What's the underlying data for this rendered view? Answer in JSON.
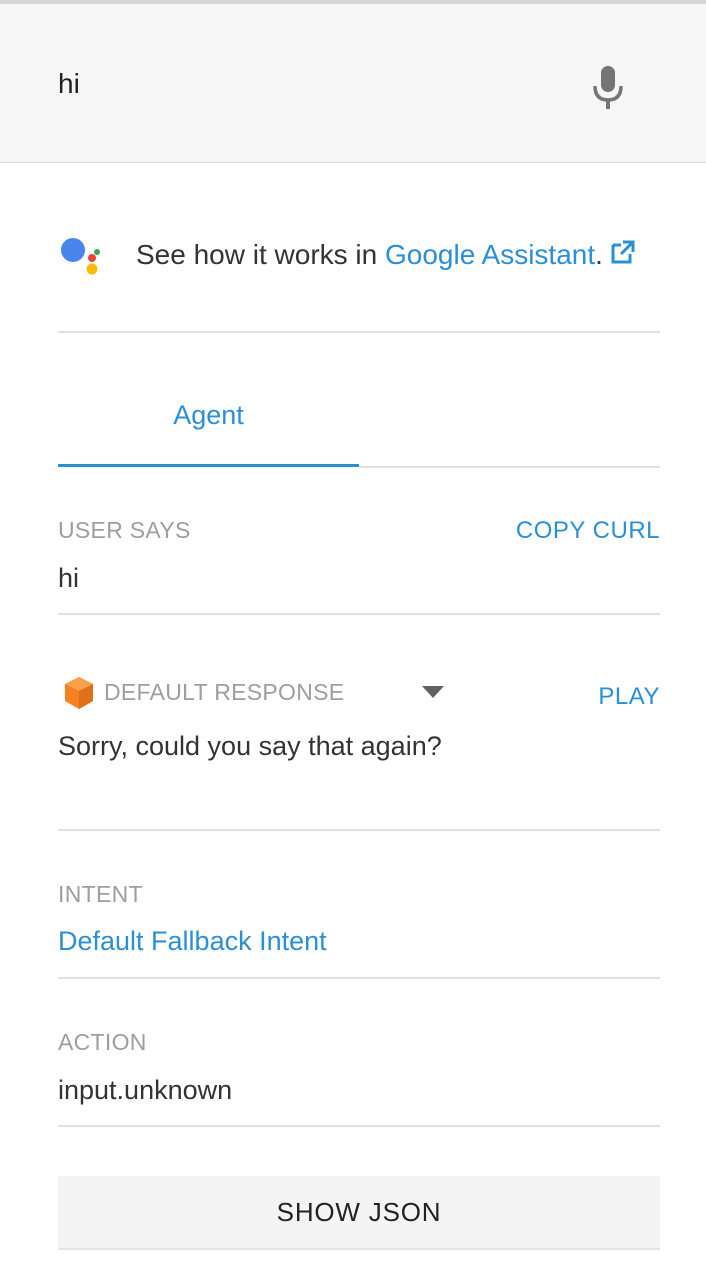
{
  "query": {
    "text": "hi",
    "mic_icon": "microphone-icon"
  },
  "assistant": {
    "prefix": "See how it works in ",
    "link_text": "Google Assistant",
    "suffix": ".",
    "logo_icon": "google-assistant-logo-icon",
    "external_icon": "external-link-icon"
  },
  "tabs": [
    {
      "label": "Agent",
      "active": true
    }
  ],
  "user_says": {
    "label": "USER SAYS",
    "value": "hi",
    "copy_label": "COPY CURL"
  },
  "response": {
    "label": "DEFAULT RESPONSE",
    "text": "Sorry, could you say that again?",
    "play_label": "PLAY",
    "bot_icon": "bot-cube-icon",
    "dropdown_icon": "chevron-down-icon"
  },
  "intent": {
    "label": "INTENT",
    "value": "Default Fallback Intent"
  },
  "action": {
    "label": "ACTION",
    "value": "input.unknown"
  },
  "show_json": {
    "label": "SHOW JSON"
  },
  "colors": {
    "accent": "#2b8fd6",
    "label_gray": "#9e9e9e",
    "bot_orange": "#f5821f"
  }
}
